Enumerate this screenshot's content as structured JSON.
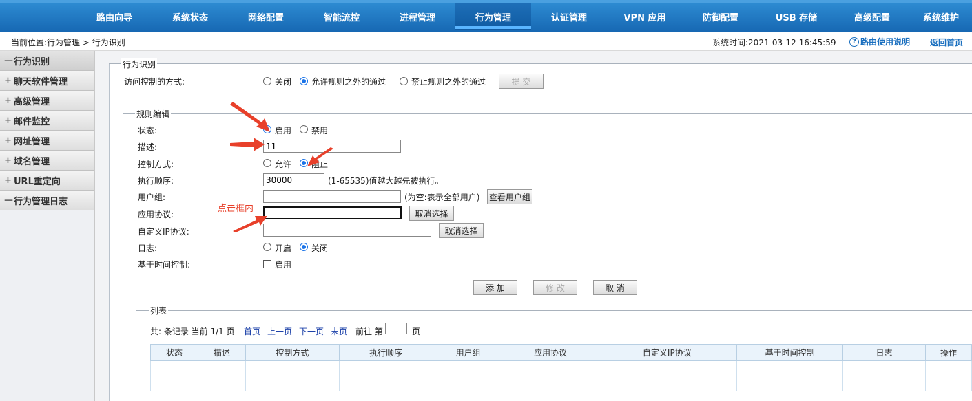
{
  "nav": {
    "items": [
      "路由向导",
      "系统状态",
      "网络配置",
      "智能流控",
      "进程管理",
      "行为管理",
      "认证管理",
      "VPN 应用",
      "防御配置",
      "USB 存储",
      "高级配置",
      "系统维护"
    ],
    "active_index": 5
  },
  "breadcrumb": "当前位置:行为管理 > 行为识别",
  "system_time": "系统时间:2021-03-12 16:45:59",
  "help_label": "路由使用说明",
  "home_label": "返回首页",
  "sidebar": {
    "items": [
      {
        "sign": "—",
        "label": "行为识别"
      },
      {
        "sign": "+",
        "label": "聊天软件管理"
      },
      {
        "sign": "+",
        "label": "高级管理"
      },
      {
        "sign": "+",
        "label": "邮件监控"
      },
      {
        "sign": "+",
        "label": "网址管理"
      },
      {
        "sign": "+",
        "label": "域名管理"
      },
      {
        "sign": "+",
        "label": "URL重定向"
      },
      {
        "sign": "—",
        "label": "行为管理日志"
      }
    ]
  },
  "section1": {
    "legend": "行为识别",
    "access_label": "访问控制的方式:",
    "options": [
      "关闭",
      "允许规则之外的通过",
      "禁止规则之外的通过"
    ],
    "selected": 1,
    "submit": "提  交"
  },
  "section2": {
    "legend": "规则编辑",
    "status_label": "状态:",
    "status_options": [
      "启用",
      "禁用"
    ],
    "desc_label": "描述:",
    "desc_value": "11",
    "control_label": "控制方式:",
    "control_options": [
      "允许",
      "阻止"
    ],
    "order_label": "执行顺序:",
    "order_value": "30000",
    "order_hint": "(1-65535)值越大越先被执行。",
    "usergroup_label": "用户组:",
    "usergroup_value": "",
    "usergroup_hint": "(为空:表示全部用户)",
    "view_usergroup": "查看用户组",
    "app_label": "应用协议:",
    "app_value": "",
    "cancel_select": "取消选择",
    "ip_label": "自定义IP协议:",
    "ip_value": "",
    "log_label": "日志:",
    "log_options": [
      "开启",
      "关闭"
    ],
    "time_label": "基于时间控制:",
    "time_check_label": "启用",
    "add": "添  加",
    "modify": "修  改",
    "cancel": "取  消"
  },
  "annotation": "点击框内",
  "list": {
    "legend": "列表",
    "pager": {
      "total": "共: 条记录 当前 1/1 页",
      "first": "首页",
      "prev": "上一页",
      "next": "下一页",
      "last": "末页",
      "goto": "前往 第",
      "page_unit": "页"
    },
    "columns": [
      "状态",
      "描述",
      "控制方式",
      "执行顺序",
      "用户组",
      "应用协议",
      "自定义IP协议",
      "基于时间控制",
      "日志",
      "操作"
    ]
  },
  "colors": {
    "nav_bg": "#1768b3",
    "link": "#1a6fbf",
    "annotation": "#e8402a",
    "radio_on": "#1a73e8"
  }
}
